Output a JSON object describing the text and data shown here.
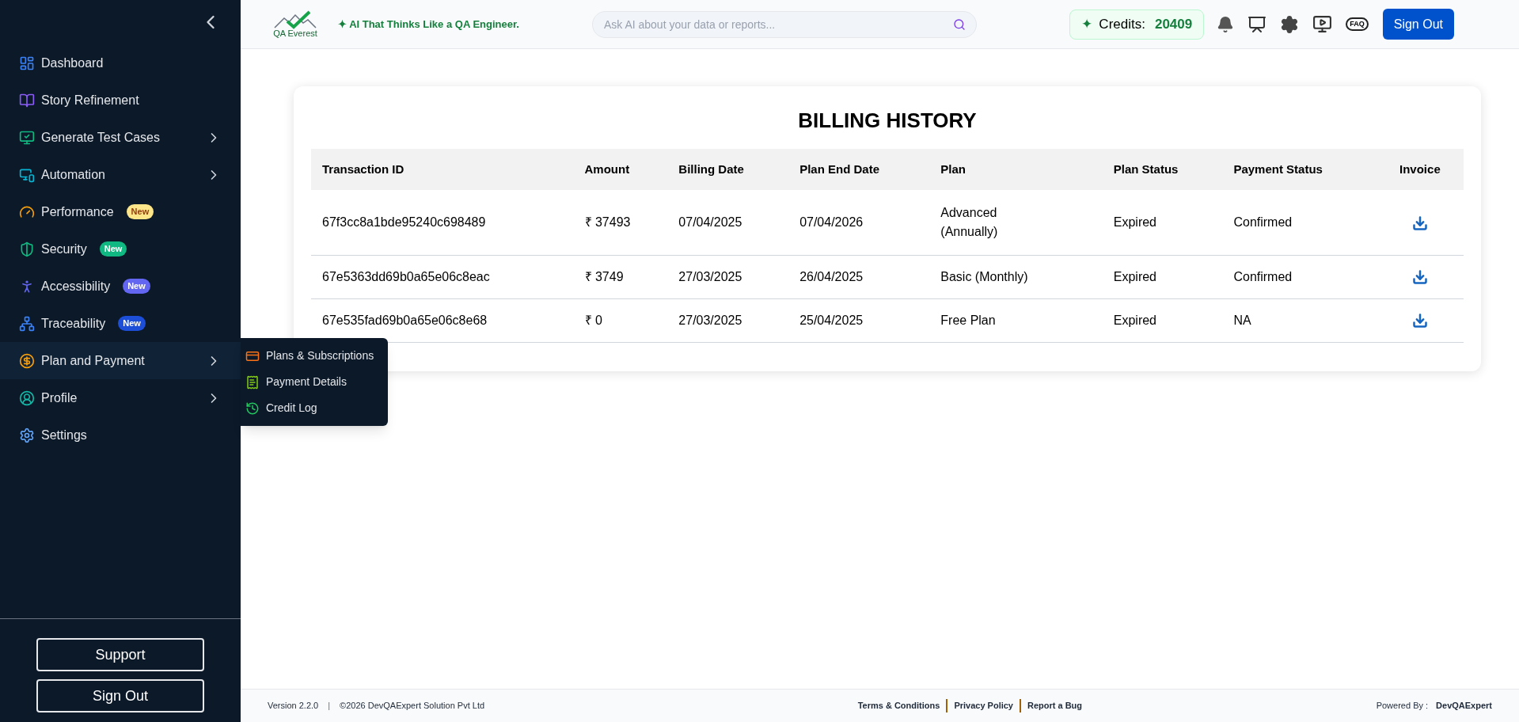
{
  "sidebar": {
    "items": [
      {
        "label": "Dashboard"
      },
      {
        "label": "Story Refinement"
      },
      {
        "label": "Generate Test Cases",
        "expanded": false
      },
      {
        "label": "Automation",
        "expanded": false
      },
      {
        "label": "Performance",
        "badge": {
          "text": "New",
          "color": "#fde68a"
        }
      },
      {
        "label": "Security",
        "badge": {
          "text": "New",
          "color": "#10b981"
        }
      },
      {
        "label": "Accessibility",
        "badge": {
          "text": "New",
          "color": "#6366f1"
        }
      },
      {
        "label": "Traceability",
        "badge": {
          "text": "New",
          "color": "#1d4ed8"
        }
      },
      {
        "label": "Plan and Payment",
        "expanded": true,
        "children": [
          {
            "label": "Plans & Subscriptions"
          },
          {
            "label": "Payment Details"
          },
          {
            "label": "Credit Log"
          }
        ]
      },
      {
        "label": "Profile",
        "expanded": false
      },
      {
        "label": "Settings"
      }
    ],
    "buttons": [
      "Support",
      "Sign Out"
    ]
  },
  "header": {
    "logo_text": "QA Everest",
    "tagline": "✦ AI That Thinks Like a QA Engineer.",
    "search": {
      "placeholder": "Ask AI about your data or reports..."
    },
    "credits": {
      "icon": "✦",
      "label": "Credits:",
      "value": "20409"
    },
    "faq_label": "FAQ",
    "sign_out": "Sign Out"
  },
  "billing": {
    "title": "BILLING HISTORY",
    "columns": [
      "Transaction ID",
      "Amount",
      "Billing Date",
      "Plan End Date",
      "Plan",
      "Plan Status",
      "Payment Status",
      "Invoice"
    ],
    "rows": [
      [
        "67f3cc8a1bde95240c698489",
        "₹ 37493",
        "07/04/2025",
        "07/04/2026",
        "Advanced (Annually)",
        "Expired",
        "Confirmed"
      ],
      [
        "67e5363dd69b0a65e06c8eac",
        "₹ 3749",
        "27/03/2025",
        "26/04/2025",
        "Basic (Monthly)",
        "Expired",
        "Confirmed"
      ],
      [
        "67e535fad69b0a65e06c8e68",
        "₹ 0",
        "27/03/2025",
        "25/04/2025",
        "Free Plan",
        "Expired",
        "NA"
      ]
    ]
  },
  "footer": {
    "version": "Version 2.2.0",
    "separator": "|",
    "copyright": "©2026 DevQAExpert Solution Pvt Ltd",
    "links": [
      "Terms & Conditions",
      "Privacy Policy",
      "Report a Bug"
    ],
    "powered_label": "Powered By :",
    "powered_by": "DevQAExpert"
  }
}
